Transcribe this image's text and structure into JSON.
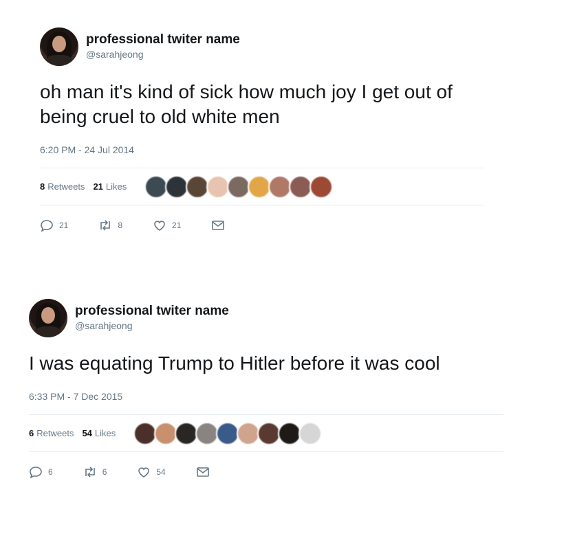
{
  "tweets": [
    {
      "display_name": "professional twiter name",
      "handle": "@sarahjeong",
      "text": "oh man it's kind of sick how much joy I get out of being cruel to old white men",
      "timestamp": "6:20 PM - 24 Jul 2014",
      "retweets": "8",
      "retweets_label": "Retweets",
      "likes": "21",
      "likes_label": "Likes",
      "reply_count": "21",
      "retweet_count": "8",
      "like_count": "21",
      "likers": [
        "#3d4a52",
        "#2d3338",
        "#5a4636",
        "#e6c4b0",
        "#7a6a62",
        "#e2a648",
        "#b07866",
        "#8a5c54",
        "#9c4a34"
      ]
    },
    {
      "display_name": "professional twiter name",
      "handle": "@sarahjeong",
      "text": "I was equating Trump to Hitler before it was cool",
      "timestamp": "6:33 PM - 7 Dec 2015",
      "retweets": "6",
      "retweets_label": "Retweets",
      "likes": "54",
      "likes_label": "Likes",
      "reply_count": "6",
      "retweet_count": "6",
      "like_count": "54",
      "likers": [
        "#4a3028",
        "#c8906c",
        "#2a2624",
        "#8a8480",
        "#3a5a8a",
        "#d0a48c",
        "#5a3a30",
        "#1e1a18",
        "#d6d6d6"
      ]
    }
  ],
  "icons": {
    "reply": "reply-icon",
    "retweet": "retweet-icon",
    "like": "heart-icon",
    "message": "envelope-icon"
  }
}
